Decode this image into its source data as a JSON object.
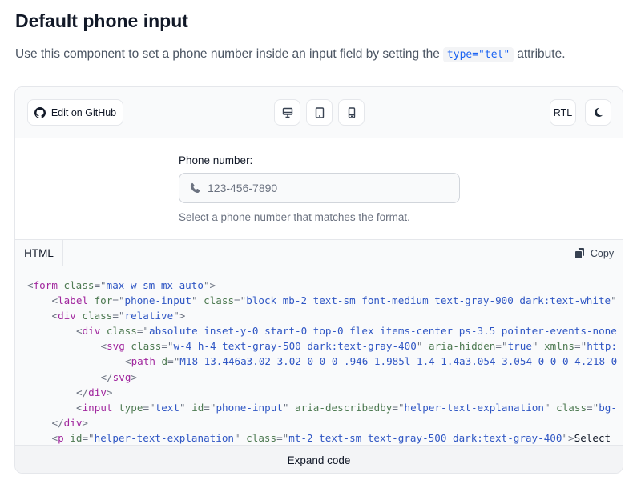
{
  "page": {
    "title": "Default phone input",
    "description_before": "Use this component to set a phone number inside an input field by setting the",
    "description_code": "type=\"tel\"",
    "description_after": "attribute."
  },
  "toolbar": {
    "github_label": "Edit on GitHub",
    "rtl_label": "RTL",
    "view_icons": [
      "desktop-icon",
      "tablet-icon",
      "mobile-icon"
    ],
    "theme_icon": "moon-icon"
  },
  "preview": {
    "label": "Phone number:",
    "placeholder": "123-456-7890",
    "value": "",
    "helper": "Select a phone number that matches the format.",
    "icon": "phone-icon"
  },
  "code": {
    "tab_label": "HTML",
    "copy_label": "Copy",
    "expand_label": "Expand code",
    "lines": [
      {
        "indent": 0,
        "tokens": [
          [
            "p",
            "<"
          ],
          [
            "tag",
            "form"
          ],
          [
            "attr",
            " class"
          ],
          [
            "p",
            "=\""
          ],
          [
            "str",
            "max-w-sm mx-auto"
          ],
          [
            "p",
            "\">"
          ]
        ]
      },
      {
        "indent": 1,
        "tokens": [
          [
            "p",
            "<"
          ],
          [
            "tag",
            "label"
          ],
          [
            "attr",
            " for"
          ],
          [
            "p",
            "=\""
          ],
          [
            "str",
            "phone-input"
          ],
          [
            "p",
            "\""
          ],
          [
            "attr",
            " class"
          ],
          [
            "p",
            "=\""
          ],
          [
            "str",
            "block mb-2 text-sm font-medium text-gray-900 dark:text-white"
          ],
          [
            "p",
            "\""
          ]
        ]
      },
      {
        "indent": 1,
        "tokens": [
          [
            "p",
            "<"
          ],
          [
            "tag",
            "div"
          ],
          [
            "attr",
            " class"
          ],
          [
            "p",
            "=\""
          ],
          [
            "str",
            "relative"
          ],
          [
            "p",
            "\">"
          ]
        ]
      },
      {
        "indent": 2,
        "tokens": [
          [
            "p",
            "<"
          ],
          [
            "tag",
            "div"
          ],
          [
            "attr",
            " class"
          ],
          [
            "p",
            "=\""
          ],
          [
            "str",
            "absolute inset-y-0 start-0 top-0 flex items-center ps-3.5 pointer-events-none"
          ]
        ]
      },
      {
        "indent": 3,
        "tokens": [
          [
            "p",
            "<"
          ],
          [
            "tag",
            "svg"
          ],
          [
            "attr",
            " class"
          ],
          [
            "p",
            "=\""
          ],
          [
            "str",
            "w-4 h-4 text-gray-500 dark:text-gray-400"
          ],
          [
            "p",
            "\""
          ],
          [
            "attr",
            " aria-hidden"
          ],
          [
            "p",
            "=\""
          ],
          [
            "str",
            "true"
          ],
          [
            "p",
            "\""
          ],
          [
            "attr",
            " xmlns"
          ],
          [
            "p",
            "=\""
          ],
          [
            "str",
            "http:"
          ]
        ]
      },
      {
        "indent": 4,
        "tokens": [
          [
            "p",
            "<"
          ],
          [
            "tag",
            "path"
          ],
          [
            "attr",
            " d"
          ],
          [
            "p",
            "=\""
          ],
          [
            "str",
            "M18 13.446a3.02 3.02 0 0 0-.946-1.985l-1.4-1.4a3.054 3.054 0 0 0-4.218 0"
          ]
        ]
      },
      {
        "indent": 3,
        "tokens": [
          [
            "p",
            "</"
          ],
          [
            "tag",
            "svg"
          ],
          [
            "p",
            ">"
          ]
        ]
      },
      {
        "indent": 2,
        "tokens": [
          [
            "p",
            "</"
          ],
          [
            "tag",
            "div"
          ],
          [
            "p",
            ">"
          ]
        ]
      },
      {
        "indent": 2,
        "tokens": [
          [
            "p",
            "<"
          ],
          [
            "tag",
            "input"
          ],
          [
            "attr",
            " type"
          ],
          [
            "p",
            "=\""
          ],
          [
            "str",
            "text"
          ],
          [
            "p",
            "\""
          ],
          [
            "attr",
            " id"
          ],
          [
            "p",
            "=\""
          ],
          [
            "str",
            "phone-input"
          ],
          [
            "p",
            "\""
          ],
          [
            "attr",
            " aria-describedby"
          ],
          [
            "p",
            "=\""
          ],
          [
            "str",
            "helper-text-explanation"
          ],
          [
            "p",
            "\""
          ],
          [
            "attr",
            " class"
          ],
          [
            "p",
            "=\""
          ],
          [
            "str",
            "bg-"
          ]
        ]
      },
      {
        "indent": 1,
        "tokens": [
          [
            "p",
            "</"
          ],
          [
            "tag",
            "div"
          ],
          [
            "p",
            ">"
          ]
        ]
      },
      {
        "indent": 1,
        "tokens": [
          [
            "p",
            "<"
          ],
          [
            "tag",
            "p"
          ],
          [
            "attr",
            " id"
          ],
          [
            "p",
            "=\""
          ],
          [
            "str",
            "helper-text-explanation"
          ],
          [
            "p",
            "\""
          ],
          [
            "attr",
            " class"
          ],
          [
            "p",
            "=\""
          ],
          [
            "str",
            "mt-2 text-sm text-gray-500 dark:text-gray-400"
          ],
          [
            "p",
            "\">"
          ],
          [
            "txt",
            "Select"
          ]
        ]
      }
    ]
  }
}
